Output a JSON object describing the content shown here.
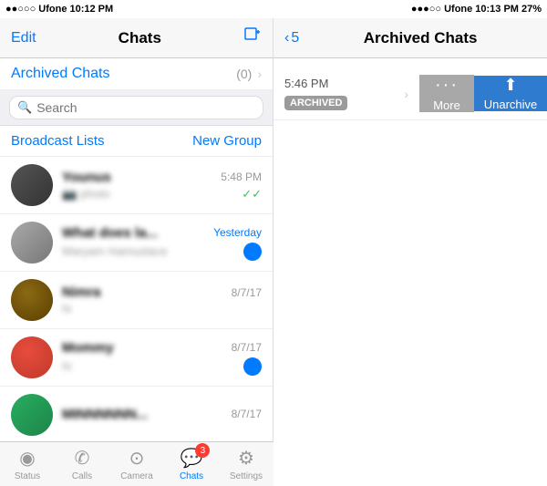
{
  "status_bar_left": {
    "carrier": "●●○○○ Ufone",
    "time": "10:12 PM"
  },
  "status_bar_right": {
    "carrier": "●●●○○ Ufone",
    "time": "10:13 PM",
    "battery": "27%"
  },
  "left_panel": {
    "nav": {
      "edit_label": "Edit",
      "title": "Chats",
      "compose_icon": "✏"
    },
    "archived_row": {
      "label": "Archived Chats",
      "count": "(0)",
      "chevron": "›"
    },
    "search": {
      "placeholder": "Search"
    },
    "broadcast_label": "Broadcast Lists",
    "new_group_label": "New Group",
    "chats": [
      {
        "name": "Younus",
        "time": "5:48 PM",
        "preview": "photo",
        "tick": "✓✓",
        "avatar_class": "avatar-dark"
      },
      {
        "name": "What does la...",
        "time": "Yesterday",
        "preview": "Maryam Hamuslace",
        "has_badge": true,
        "badge_count": "",
        "avatar_class": "avatar-placeholder"
      },
      {
        "name": "Nimra",
        "time": "8/7/17",
        "preview": "hi",
        "avatar_class": "avatar-brown"
      },
      {
        "name": "Mommy",
        "time": "8/7/17",
        "preview": "hi",
        "has_badge": true,
        "badge_count": "",
        "avatar_class": "avatar-red"
      },
      {
        "name": "MINNNNNN...",
        "time": "8/7/17",
        "preview": "",
        "avatar_class": "avatar-green"
      }
    ]
  },
  "tab_bar": {
    "items": [
      {
        "label": "Status",
        "icon": "◉",
        "active": false
      },
      {
        "label": "Calls",
        "icon": "✆",
        "active": false
      },
      {
        "label": "Camera",
        "icon": "⊙",
        "active": false
      },
      {
        "label": "Chats",
        "icon": "💬",
        "active": true,
        "badge": "3"
      },
      {
        "label": "Settings",
        "icon": "⚙",
        "active": false
      }
    ]
  },
  "right_panel": {
    "nav": {
      "back_icon": "‹",
      "back_count": "5",
      "title": "Archived Chats"
    },
    "swipe_item": {
      "time": "5:46 PM",
      "archived_label": "ARCHIVED",
      "arrow": "›"
    },
    "action_more": {
      "label": "More",
      "icon": "···"
    },
    "action_unarchive": {
      "label": "Unarchive",
      "icon": "⬆"
    }
  }
}
